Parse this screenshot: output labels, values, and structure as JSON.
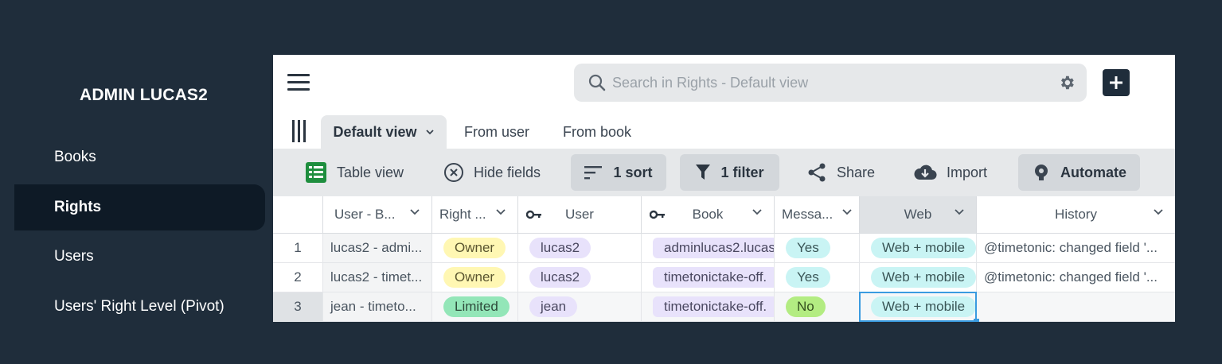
{
  "app": {
    "title": "ADMIN LUCAS2"
  },
  "sidebar": {
    "items": [
      {
        "label": "Books",
        "active": false
      },
      {
        "label": "Rights",
        "active": true
      },
      {
        "label": "Users",
        "active": false
      },
      {
        "label": "Users' Right Level (Pivot)",
        "active": false
      }
    ]
  },
  "search": {
    "placeholder": "Search in Rights - Default view",
    "value": ""
  },
  "tabs": [
    {
      "label": "Default view",
      "active": true
    },
    {
      "label": "From user",
      "active": false
    },
    {
      "label": "From book",
      "active": false
    }
  ],
  "toolbar": {
    "table_view": "Table view",
    "hide_fields": "Hide fields",
    "sort": "1 sort",
    "filter": "1 filter",
    "share": "Share",
    "import": "Import",
    "automate": "Automate"
  },
  "table": {
    "columns": [
      "User - B...",
      "Right ...",
      "User",
      "Book",
      "Messa...",
      "Web",
      "History"
    ],
    "rows": [
      {
        "num": "1",
        "user_book": "lucas2 - admi...",
        "right": "Owner",
        "user": "lucas2",
        "book": "adminlucas2.lucas",
        "message": "Yes",
        "web": "Web + mobile",
        "history": "@timetonic: changed field '..."
      },
      {
        "num": "2",
        "user_book": "lucas2 - timet...",
        "right": "Owner",
        "user": "lucas2",
        "book": "timetonictake-off.",
        "message": "Yes",
        "web": "Web + mobile",
        "history": "@timetonic: changed field '..."
      },
      {
        "num": "3",
        "user_book": "jean - timeto...",
        "right": "Limited",
        "user": "jean",
        "book": "timetonictake-off.",
        "message": "No",
        "web": "Web + mobile",
        "history": ""
      }
    ]
  },
  "colors": {
    "background": "#1f2d3b",
    "sidebar_active": "#0e1a26",
    "owner_pill": "#fff7b3",
    "limited_pill": "#93e6b8",
    "user_pill": "#e8e2fb",
    "yes_pill": "#c9f4f4",
    "no_pill": "#b3ec82",
    "selection": "#3a9be0",
    "sheets_icon": "#1e8e3e"
  }
}
